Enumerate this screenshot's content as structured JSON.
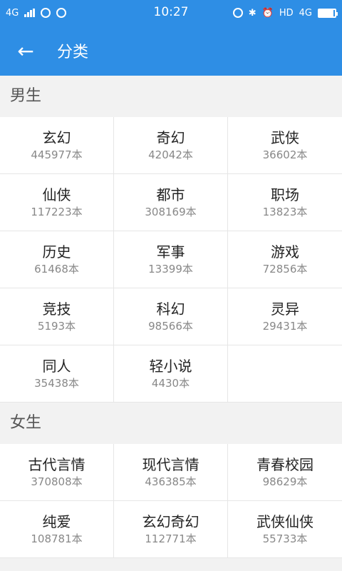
{
  "status_bar": {
    "time": "10:27",
    "net_left": "4G",
    "hd": "HD",
    "net_right": "4G",
    "battery_level": 0.9
  },
  "header": {
    "back_icon": "arrow-left-icon",
    "title": "分类"
  },
  "sections": [
    {
      "title": "男生",
      "categories": [
        {
          "name": "玄幻",
          "count": "445977本"
        },
        {
          "name": "奇幻",
          "count": "42042本"
        },
        {
          "name": "武侠",
          "count": "36602本"
        },
        {
          "name": "仙侠",
          "count": "117223本"
        },
        {
          "name": "都市",
          "count": "308169本"
        },
        {
          "name": "职场",
          "count": "13823本"
        },
        {
          "name": "历史",
          "count": "61468本"
        },
        {
          "name": "军事",
          "count": "13399本"
        },
        {
          "name": "游戏",
          "count": "72856本"
        },
        {
          "name": "竞技",
          "count": "5193本"
        },
        {
          "name": "科幻",
          "count": "98566本"
        },
        {
          "name": "灵异",
          "count": "29431本"
        },
        {
          "name": "同人",
          "count": "35438本"
        },
        {
          "name": "轻小说",
          "count": "4430本"
        }
      ]
    },
    {
      "title": "女生",
      "categories": [
        {
          "name": "古代言情",
          "count": "370808本"
        },
        {
          "name": "现代言情",
          "count": "436385本"
        },
        {
          "name": "青春校园",
          "count": "98629本"
        },
        {
          "name": "纯爱",
          "count": "108781本"
        },
        {
          "name": "玄幻奇幻",
          "count": "112771本"
        },
        {
          "name": "武侠仙侠",
          "count": "55733本"
        }
      ]
    }
  ]
}
